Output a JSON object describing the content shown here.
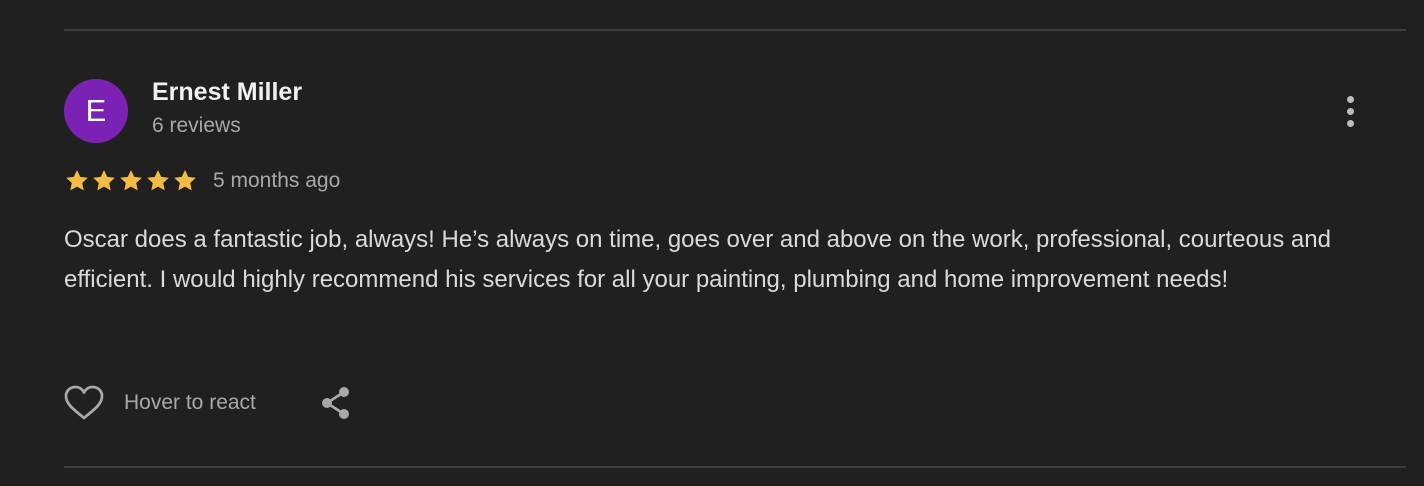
{
  "reviewer": {
    "initial": "E",
    "name": "Ernest Miller",
    "meta": "6 reviews",
    "avatar_color": "#7b22b5"
  },
  "rating": {
    "stars": 5,
    "max_stars": 5,
    "star_color": "#f6bb42",
    "date": "5 months ago"
  },
  "review": {
    "text": "Oscar does a fantastic job, always! He’s always on time, goes over and above on the work, professional, courteous and efficient. I would highly recommend his services for all your painting, plumbing and home improvement needs!"
  },
  "actions": {
    "react_label": "Hover to react",
    "react_icon": "heart-outline-icon",
    "share_icon": "share-icon",
    "more_icon": "more-vertical-icon"
  }
}
